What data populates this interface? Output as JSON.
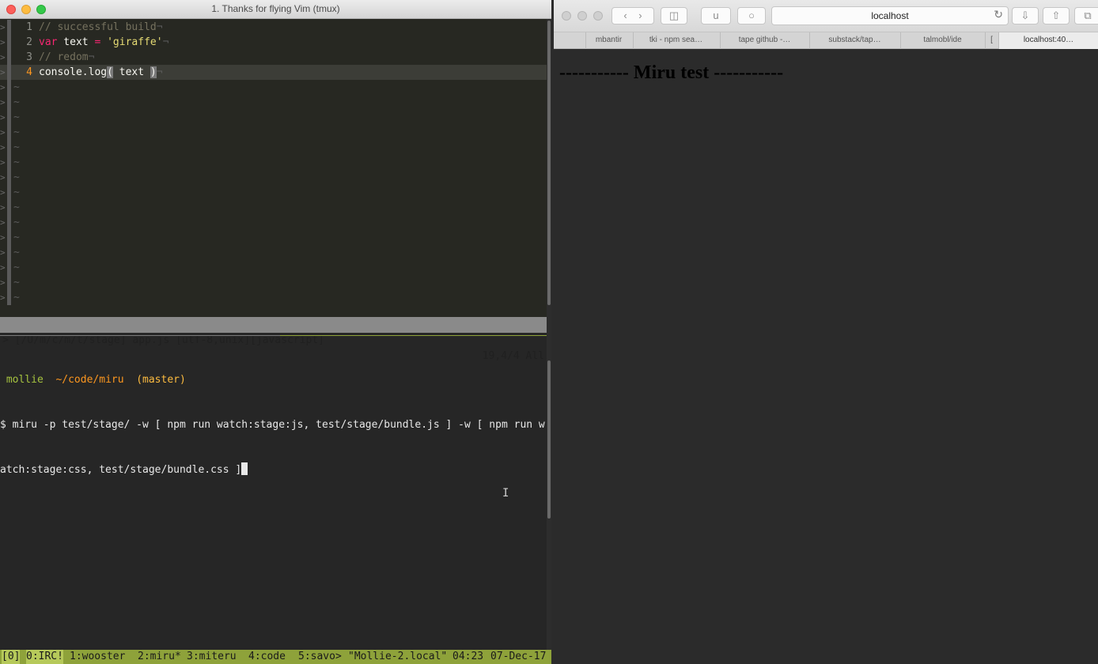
{
  "terminal": {
    "title": "1. Thanks for flying Vim (tmux)",
    "vim": {
      "lines": [
        {
          "num": "1",
          "parts": [
            {
              "cls": "c-comment",
              "text": "// successful build"
            },
            {
              "cls": "c-eol",
              "text": "¬"
            }
          ]
        },
        {
          "num": "2",
          "parts": [
            {
              "cls": "c-key",
              "text": "var"
            },
            {
              "cls": "",
              "text": " text "
            },
            {
              "cls": "c-key",
              "text": "="
            },
            {
              "cls": "",
              "text": " "
            },
            {
              "cls": "c-str",
              "text": "'giraffe'"
            },
            {
              "cls": "c-eol",
              "text": "¬"
            }
          ]
        },
        {
          "num": "3",
          "parts": [
            {
              "cls": "c-comment",
              "text": "// redom"
            },
            {
              "cls": "c-eol",
              "text": "¬"
            }
          ]
        },
        {
          "num": "4",
          "parts": [
            {
              "cls": "",
              "text": "console.log"
            },
            {
              "cls": "c-paren",
              "text": "("
            },
            {
              "cls": "",
              "text": " text "
            },
            {
              "cls": "c-paren",
              "text": ")"
            },
            {
              "cls": "c-eol",
              "text": "¬"
            }
          ]
        }
      ],
      "tilde": "~",
      "gutter_mark": ">",
      "status_left": "> [/U/m/c/m/t/stage] app.js [utf-8,unix][javascript]",
      "status_right": "19,4/4 All"
    },
    "shell": {
      "user": "mollie",
      "path": "~/code/miru",
      "branch": "(master)",
      "command_line1": "$ miru -p test/stage/ -w [ npm run watch:stage:js, test/stage/bundle.js ] -w [ npm run w",
      "command_line2": "atch:stage:css, test/stage/bundle.css ]"
    },
    "tmux": {
      "session": "[0]",
      "windows": [
        "0:IRC!",
        "1:wooster",
        "2:miru*",
        "3:miteru",
        "4:code",
        "5:savo>"
      ],
      "host": "\"Mollie-2.local\"",
      "time": "04:23",
      "date": "07-Dec-17"
    },
    "ibeam": "I"
  },
  "browser": {
    "url": "localhost",
    "tabs": [
      "mbantir",
      "tki - npm sea…",
      "tape github -…",
      "substack/tap…",
      "talmobl/ide",
      "[",
      "localhost:40…"
    ],
    "reader_label": "u",
    "heading": "----------- Miru test -----------"
  }
}
